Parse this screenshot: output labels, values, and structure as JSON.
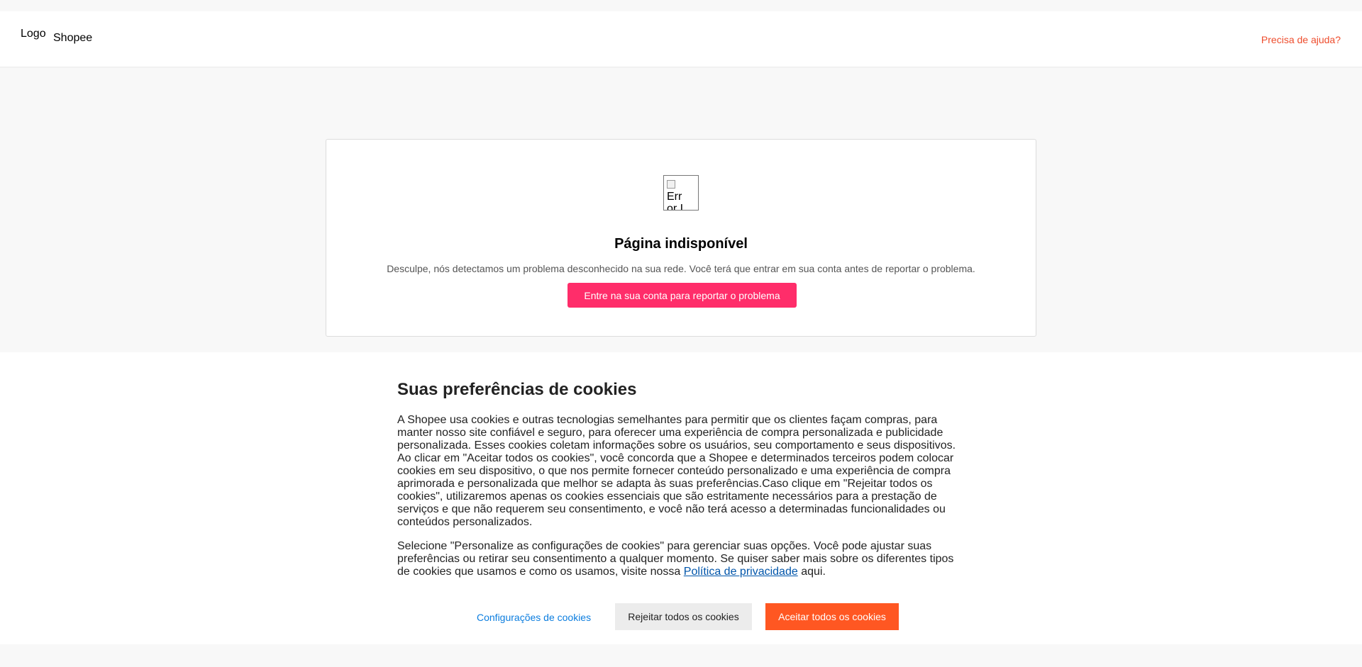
{
  "header": {
    "logo_alt": "Logo",
    "brand": "Shopee",
    "help_link": "Precisa de ajuda?"
  },
  "error": {
    "icon_alt": "Error Icon",
    "title": "Página indisponível",
    "description": "Desculpe, nós detectamos um problema desconhecido na sua rede. Você terá que entrar em sua conta antes de reportar o problema.",
    "button_label": "Entre na sua conta para reportar o problema"
  },
  "cookies": {
    "title": "Suas preferências de cookies",
    "paragraph1": "A Shopee usa cookies e outras tecnologias semelhantes para permitir que os clientes façam compras, para manter nosso site confiável e seguro, para oferecer uma experiência de compra personalizada e publicidade personalizada. Esses cookies coletam informações sobre os usuários, seu comportamento e seus dispositivos. Ao clicar em \"Aceitar todos os cookies\", você concorda que a Shopee e determinados terceiros podem colocar cookies em seu dispositivo, o que nos permite fornecer conteúdo personalizado e uma experiência de compra aprimorada e personalizada que melhor se adapta às suas preferências.Caso clique em \"Rejeitar todos os cookies\", utilizaremos apenas os cookies essenciais que são estritamente necessários para a prestação de serviços e que não requerem seu consentimento, e você não terá acesso a determinadas funcionalidades ou conteúdos personalizados.",
    "paragraph2_before": "Selecione \"Personalize as configurações de cookies\" para gerenciar suas opções. Você pode ajustar suas preferências ou retirar seu consentimento a qualquer momento. Se quiser saber mais sobre os diferentes tipos de cookies que usamos e como os usamos, visite nossa ",
    "privacy_link": "Política de privacidade",
    "paragraph2_after": " aqui.",
    "settings_label": "Configurações de cookies",
    "reject_label": "Rejeitar todos os cookies",
    "accept_label": "Aceitar todos os cookies"
  },
  "colors": {
    "brand_orange": "#ee4d2d",
    "report_pink": "#ff2d6a",
    "accept_orange": "#ff5722",
    "link_blue": "#0b7ddf"
  }
}
